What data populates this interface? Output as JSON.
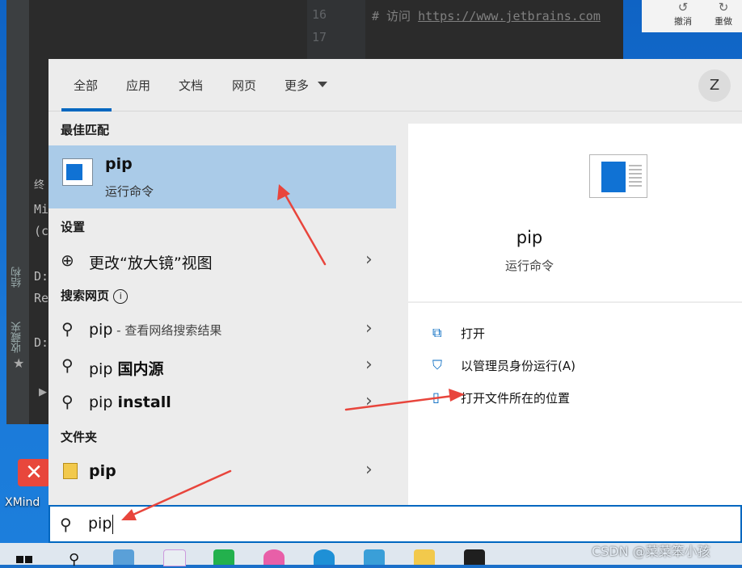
{
  "ide": {
    "line_numbers": [
      "16",
      "17"
    ],
    "comment_prefix": "# 访问 ",
    "comment_url": "https://www.jetbrains.com",
    "terminal_header": "终",
    "terminal_lines": [
      "Mi",
      "(c",
      "D:",
      "Re",
      "D:"
    ],
    "left_labels": [
      "结构",
      "收藏夹"
    ],
    "toolbar": {
      "undo_label": "撤消",
      "redo_label": "重做"
    }
  },
  "desktop": {
    "xmind_label": "XMind"
  },
  "search": {
    "tabs": [
      "全部",
      "应用",
      "文档",
      "网页",
      "更多"
    ],
    "avatar_letter": "Z",
    "best_match_header": "最佳匹配",
    "best_match": {
      "title": "pip",
      "subtitle": "运行命令"
    },
    "settings_header": "设置",
    "settings_item": "更改“放大镜”视图",
    "web_header": "搜索网页",
    "web_items": [
      {
        "main": "pip",
        "sub": " - 查看网络搜索结果"
      },
      {
        "main": "pip ",
        "bold": "国内源"
      },
      {
        "main": "pip ",
        "bold": "install"
      }
    ],
    "folder_header": "文件夹",
    "folder_item": "pip",
    "preview": {
      "title": "pip",
      "subtitle": "运行命令"
    },
    "actions": [
      "打开",
      "以管理员身份运行(A)",
      "打开文件所在的位置"
    ],
    "query": "pip"
  },
  "watermark": "CSDN @菜菜笨小孩",
  "colors": {
    "accent": "#0067c0",
    "selection": "#aacbe8",
    "arrow": "#e8453c"
  }
}
